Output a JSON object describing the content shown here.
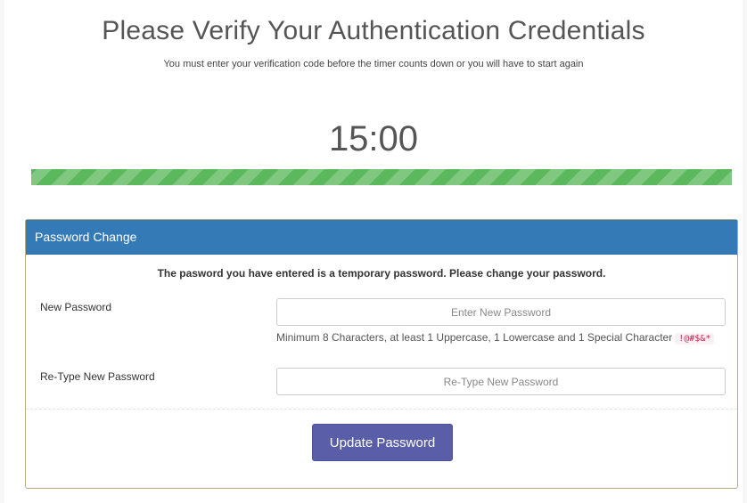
{
  "header": {
    "title": "Please Verify Your Authentication Credentials",
    "subtitle": "You must enter your verification code before the timer counts down or you will have to start again"
  },
  "timer": {
    "value": "15:00",
    "progress_percent": 100,
    "bar_color": "#5cb85c"
  },
  "panel": {
    "heading": "Password Change",
    "heading_color": "#337ab7",
    "notice": "The pasword you have entered is a temporary password. Please change your password.",
    "new_password": {
      "label": "New Password",
      "placeholder": "Enter New Password",
      "value": ""
    },
    "help_text": "Minimum 8 Characters, at least 1 Uppercase, 1 Lowercase and 1 Special Character",
    "special_chars": "!@#$&*",
    "retype_password": {
      "label": "Re-Type New Password",
      "placeholder": "Re-Type New Password",
      "value": ""
    },
    "submit_label": "Update Password",
    "submit_color": "#5a5ea8"
  }
}
